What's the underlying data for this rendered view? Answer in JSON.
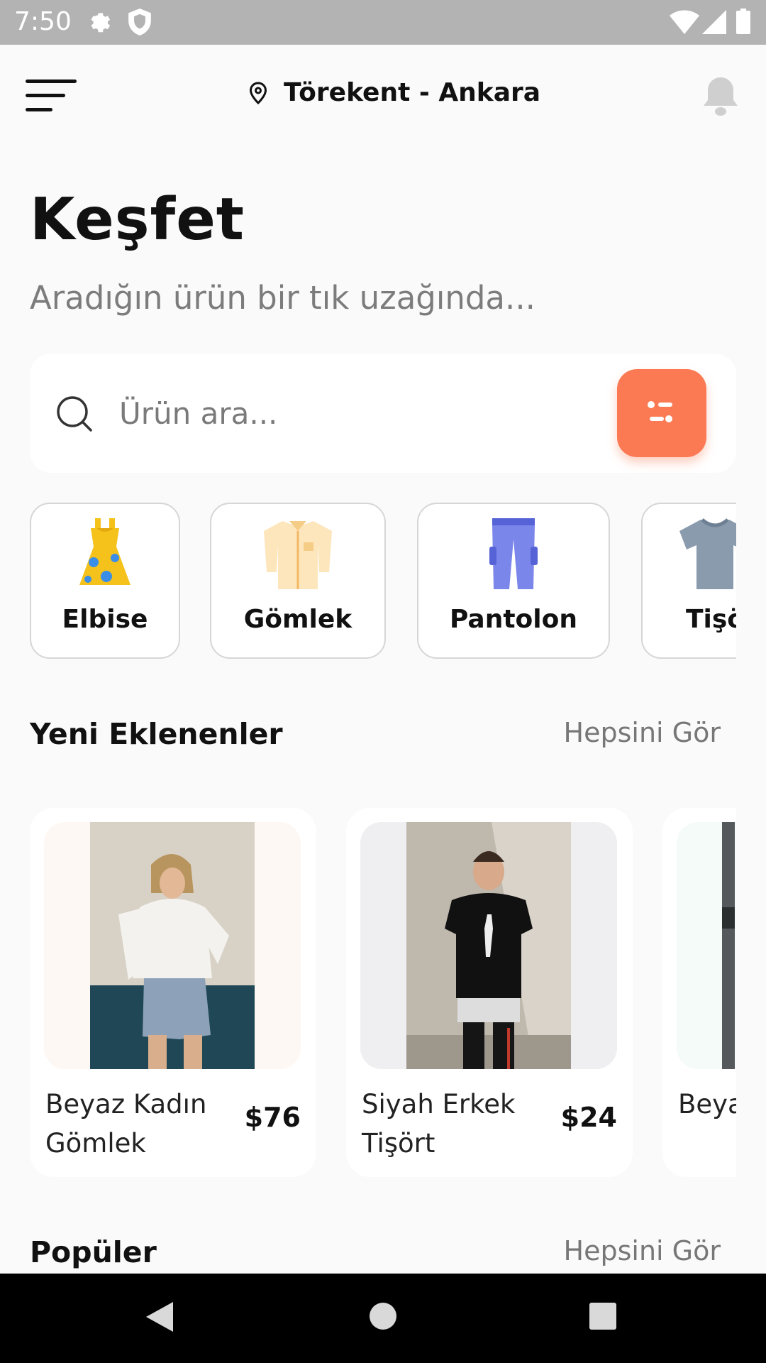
{
  "status_bar": {
    "time": "7:50"
  },
  "header": {
    "location": "Törekent - Ankara"
  },
  "page": {
    "title": "Keşfet",
    "subtitle": "Aradığın ürün bir tık uzağında..."
  },
  "search": {
    "placeholder": "Ürün ara..."
  },
  "categories": [
    {
      "label": "Elbise",
      "icon": "dress-icon"
    },
    {
      "label": "Gömlek",
      "icon": "shirt-icon"
    },
    {
      "label": "Pantolon",
      "icon": "pants-icon"
    },
    {
      "label": "Tişört",
      "icon": "tshirt-icon"
    }
  ],
  "new_section": {
    "title": "Yeni Eklenenler",
    "see_all": "Hepsini Gör"
  },
  "products": [
    {
      "name": "Beyaz Kadın Gömlek",
      "price": "$76"
    },
    {
      "name": "Siyah Erkek Tişört",
      "price": "$24"
    },
    {
      "name": "Beyaz Tişört",
      "price": ""
    }
  ],
  "popular_section": {
    "title": "Popüler",
    "see_all": "Hepsini Gör"
  },
  "colors": {
    "accent": "#fb7a53",
    "background": "#fafafa"
  }
}
